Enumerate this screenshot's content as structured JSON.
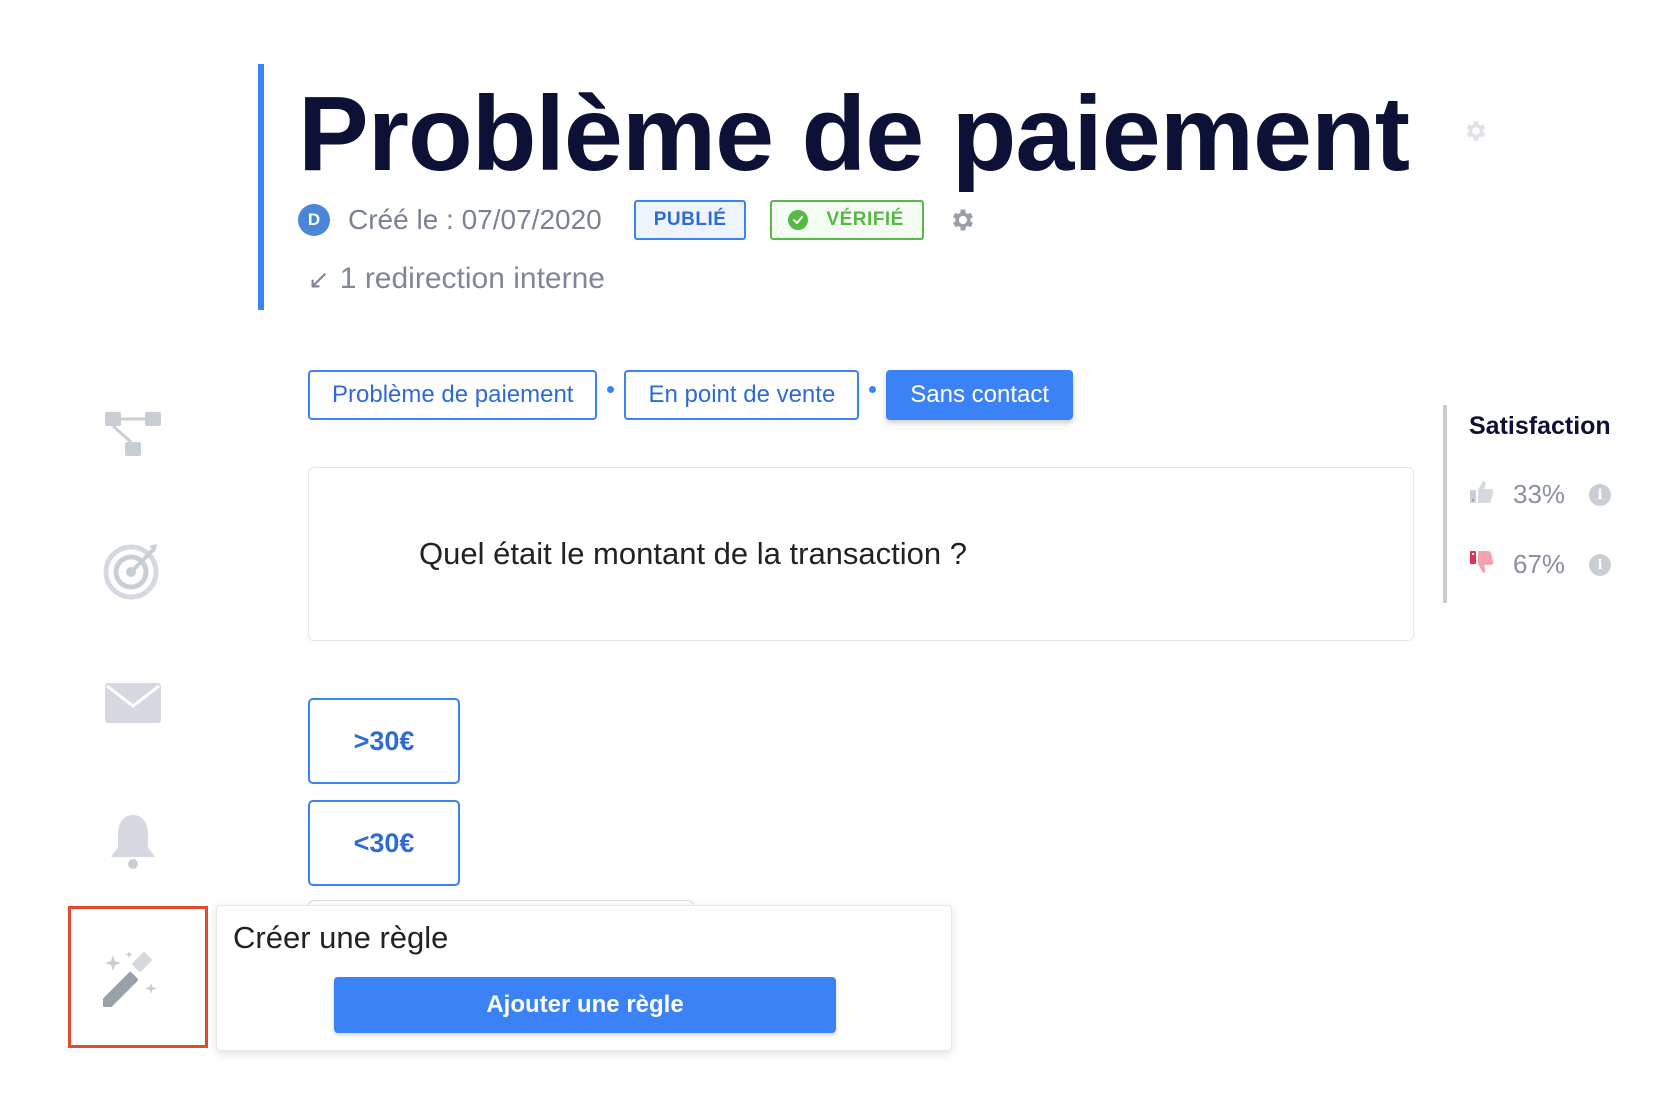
{
  "header": {
    "title": "Problème de paiement",
    "avatar_initial": "D",
    "created": "Créé le : 07/07/2020",
    "badge_published": "PUBLIÉ",
    "badge_verified": "VÉRIFIÉ",
    "redirect_arrow": "↙",
    "redirect_text": "1 redirection interne"
  },
  "sidebar": {
    "icons": [
      "tree-icon",
      "target-icon",
      "mail-icon",
      "bell-icon",
      "magic-wand-icon"
    ]
  },
  "breadcrumb": {
    "items": [
      {
        "label": "Problème de paiement",
        "active": false
      },
      {
        "label": "En point de vente",
        "active": false
      },
      {
        "label": "Sans contact",
        "active": true
      }
    ]
  },
  "question": {
    "text": "Quel était le montant de la transaction ?"
  },
  "answers": [
    {
      "label": ">30€"
    },
    {
      "label": "<30€"
    }
  ],
  "popup": {
    "title": "Créer une règle",
    "button_label": "Ajouter une règle"
  },
  "satisfaction": {
    "title": "Satisfaction",
    "positive": "33%",
    "negative": "67%",
    "info_glyph": "i"
  },
  "colors": {
    "accent": "#3b82f6",
    "verified": "#58b847",
    "title": "#0d1136",
    "highlight": "#e04a2f"
  }
}
